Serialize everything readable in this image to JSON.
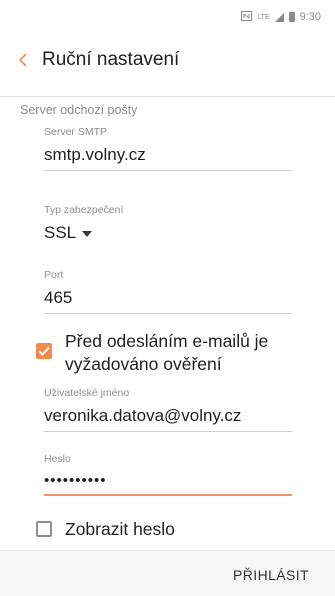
{
  "status_bar": {
    "time": "9:30",
    "network": "LTE"
  },
  "app_bar": {
    "title": "Ruční nastavení",
    "back_icon": "chevron-left-icon"
  },
  "section": {
    "title": "Server odchozí pošty"
  },
  "fields": {
    "smtp": {
      "label": "Server SMTP",
      "value": "smtp.volny.cz"
    },
    "security": {
      "label": "Typ zabezpečení",
      "value": "SSL"
    },
    "port": {
      "label": "Port",
      "value": "465"
    },
    "username": {
      "label": "Uživatelské jméno",
      "value": "veronika.datova@volny.cz"
    },
    "password": {
      "label": "Heslo",
      "value": "••••••••••"
    }
  },
  "checkboxes": {
    "auth_required": {
      "label_line1": "Před odesláním e-mailů je",
      "label_line2": "vyžadováno ověření",
      "checked": true
    },
    "show_password": {
      "label": "Zobrazit heslo",
      "checked": false
    }
  },
  "actions": {
    "login": "PŘIHLÁSIT"
  },
  "colors": {
    "accent": "#f08a4f",
    "active_underline": "#f0946c"
  }
}
